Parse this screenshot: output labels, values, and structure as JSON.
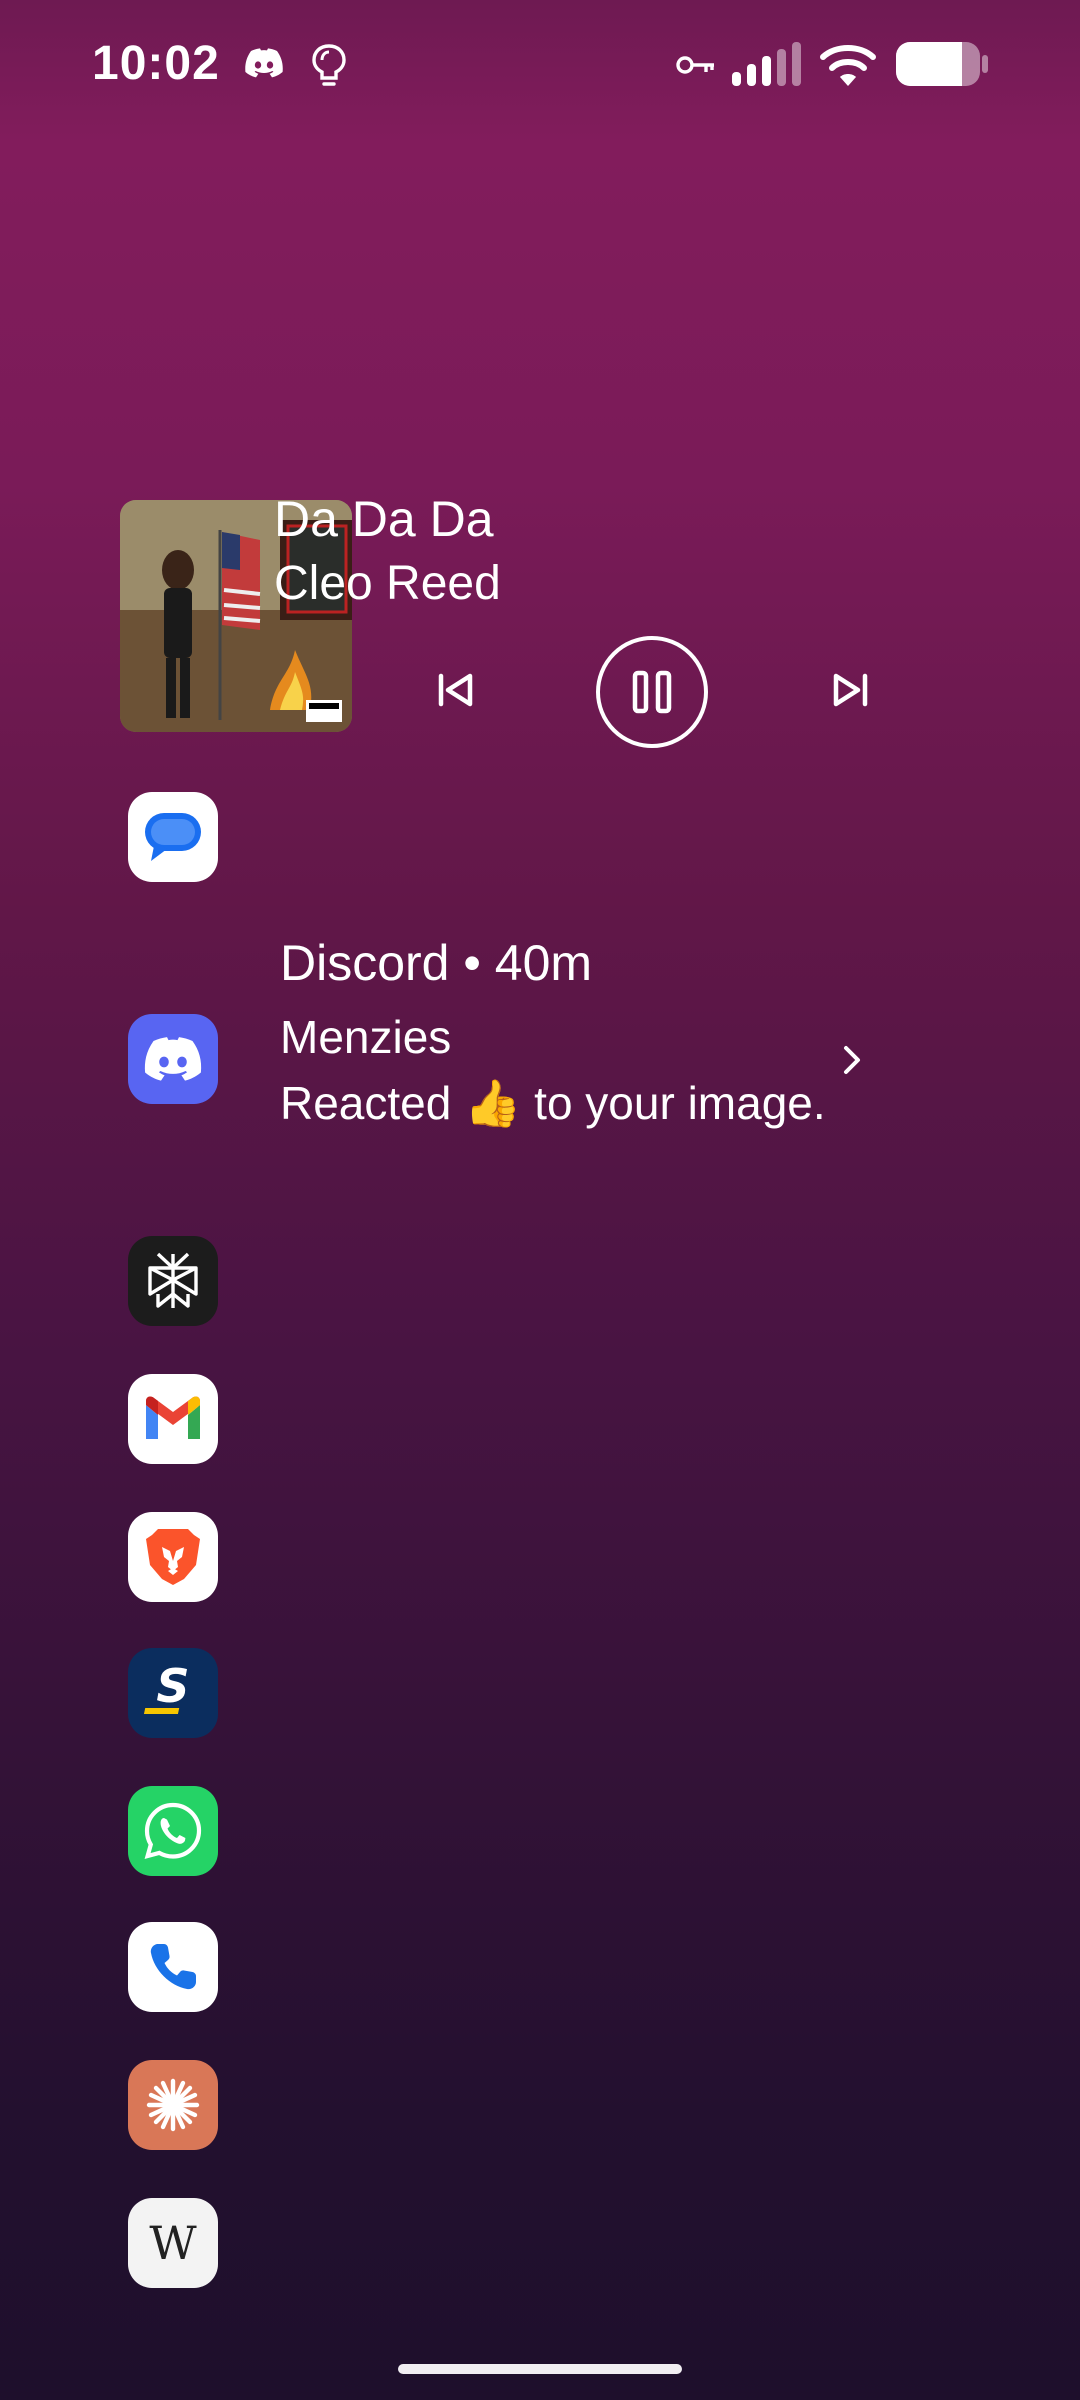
{
  "status_bar": {
    "time": "10:02",
    "icons": [
      "discord-icon",
      "hint-bulb-icon",
      "vpn-key-icon",
      "signal-icon",
      "wifi-icon",
      "battery-icon"
    ]
  },
  "media": {
    "title": "Da Da Da",
    "artist": "Cleo Reed",
    "state": "playing",
    "controls": [
      "previous-icon",
      "pause-icon",
      "next-icon"
    ]
  },
  "notification": {
    "app": "Discord",
    "time": "40m",
    "header": "Discord • 40m",
    "sender": "Menzies",
    "message": "Reacted 👍 to your image."
  },
  "apps": [
    {
      "name": "Google Messages",
      "icon": "messages-icon"
    },
    {
      "name": "Discord",
      "icon": "discord-icon"
    },
    {
      "name": "Perplexity",
      "icon": "perplexity-icon"
    },
    {
      "name": "Gmail",
      "icon": "gmail-icon"
    },
    {
      "name": "Brave",
      "icon": "brave-lion-icon"
    },
    {
      "name": "theScore",
      "icon": "score-icon"
    },
    {
      "name": "WhatsApp",
      "icon": "whatsapp-icon"
    },
    {
      "name": "Phone",
      "icon": "phone-icon"
    },
    {
      "name": "Claude",
      "icon": "claude-icon"
    },
    {
      "name": "Wikipedia",
      "icon": "wikipedia-icon"
    }
  ],
  "colors": {
    "background_top": "#821c5c",
    "background_bottom": "#1e0f2c",
    "discord": "#5865f2",
    "whatsapp": "#25d366",
    "claude": "#d97757"
  }
}
